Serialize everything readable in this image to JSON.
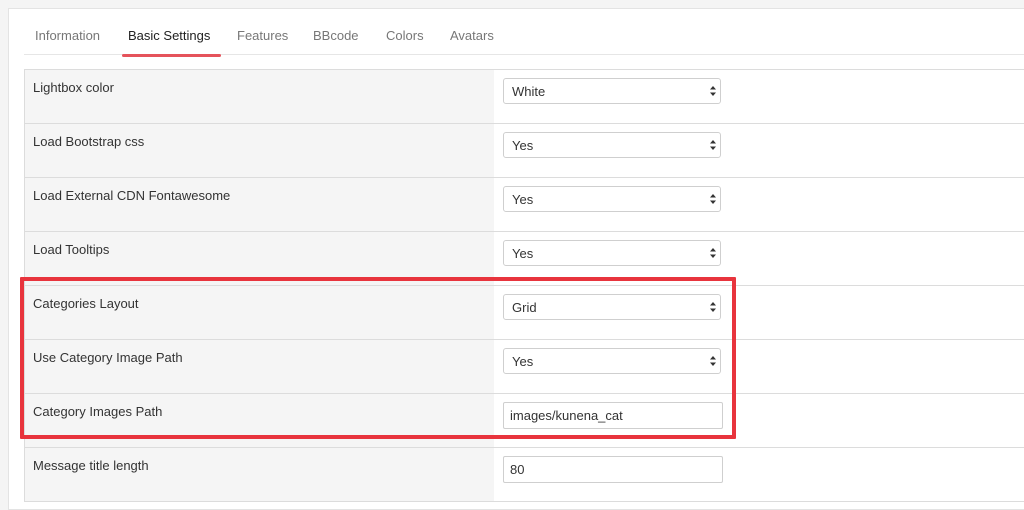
{
  "tabs": [
    {
      "label": "Information"
    },
    {
      "label": "Basic Settings",
      "active": true
    },
    {
      "label": "Features"
    },
    {
      "label": "BBcode"
    },
    {
      "label": "Colors"
    },
    {
      "label": "Avatars"
    }
  ],
  "settings": [
    {
      "label": "Lightbox color",
      "control": "select",
      "value": "White"
    },
    {
      "label": "Load Bootstrap css",
      "control": "select",
      "value": "Yes"
    },
    {
      "label": "Load External CDN Fontawesome",
      "control": "select",
      "value": "Yes"
    },
    {
      "label": "Load Tooltips",
      "control": "select",
      "value": "Yes"
    },
    {
      "label": "Categories Layout",
      "control": "select",
      "value": "Grid"
    },
    {
      "label": "Use Category Image Path",
      "control": "select",
      "value": "Yes"
    },
    {
      "label": "Category Images Path",
      "control": "text",
      "value": "images/kunena_cat"
    },
    {
      "label": "Message title length",
      "control": "text",
      "value": "80"
    }
  ],
  "colors": {
    "accent_underline": "#e5535b",
    "highlight_border": "#e8343d"
  }
}
